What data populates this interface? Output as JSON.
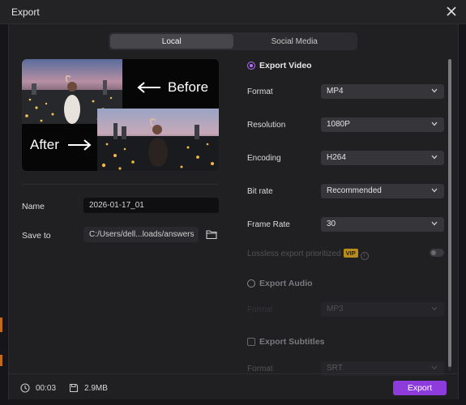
{
  "window": {
    "title": "Export"
  },
  "tabs": [
    {
      "label": "Local",
      "active": true
    },
    {
      "label": "Social Media",
      "active": false
    }
  ],
  "preview": {
    "before_label": "Before",
    "after_label": "After"
  },
  "left": {
    "name_label": "Name",
    "name_value": "2026-01-17_01",
    "save_label": "Save to",
    "save_value": "C:/Users/dell...loads/answers"
  },
  "export_video": {
    "label": "Export Video",
    "selected": true,
    "rows": [
      {
        "label": "Format",
        "value": "MP4"
      },
      {
        "label": "Resolution",
        "value": "1080P"
      },
      {
        "label": "Encoding",
        "value": "H264"
      },
      {
        "label": "Bit rate",
        "value": "Recommended"
      },
      {
        "label": "Frame Rate",
        "value": "30"
      }
    ],
    "lossless_label": "Lossless export prioritized",
    "vip_badge": "VIP"
  },
  "export_audio": {
    "label": "Export Audio",
    "format_label": "Format",
    "format_value": "MP3"
  },
  "export_subtitles": {
    "label": "Export Subtitles",
    "format_label": "Format",
    "format_value": "SRT"
  },
  "footer": {
    "duration": "00:03",
    "size": "2.9MB",
    "export_button": "Export"
  },
  "colors": {
    "accent": "#8e3bdc",
    "radio_on": "#b96cff",
    "vip": "#b88c1c"
  }
}
